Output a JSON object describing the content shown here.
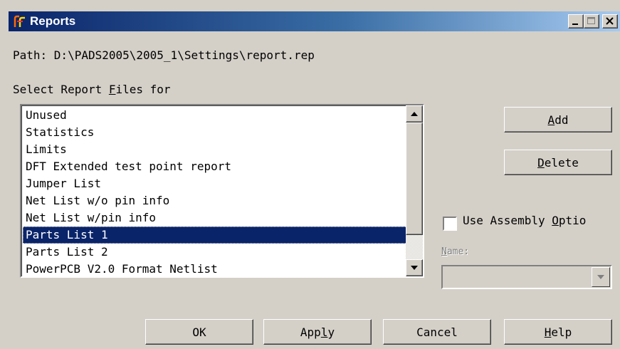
{
  "window": {
    "title": "Reports",
    "minimize_icon": "minimize-icon",
    "maximize_icon": "maximize-icon",
    "close_icon": "close-icon"
  },
  "path_text": "Path: D:\\PADS2005\\2005_1\\Settings\\report.rep",
  "select_label": {
    "prefix": "Select Report ",
    "mnemonic": "F",
    "suffix": "iles for"
  },
  "report_list": {
    "items": [
      "Unused",
      "Statistics",
      "Limits",
      "DFT Extended test point report",
      "Jumper List",
      "Net List w/o pin info",
      "Net List w/pin info",
      "Parts List 1",
      "Parts List 2",
      "PowerPCB V2.0 Format Netlist"
    ],
    "selected": "Parts List 1"
  },
  "buttons": {
    "add": {
      "mnemonic": "A",
      "rest": "dd"
    },
    "delete": {
      "mnemonic": "D",
      "rest": "elete"
    },
    "ok": "OK",
    "apply": {
      "pre": "App",
      "mnemonic": "l",
      "rest": "y"
    },
    "cancel": "Cancel",
    "help": {
      "mnemonic": "H",
      "rest": "elp"
    }
  },
  "assembly_option": {
    "prefix": "Use Assembly ",
    "mnemonic": "O",
    "suffix": "ptio",
    "checked": false
  },
  "name_field": {
    "prefix": "",
    "mnemonic": "N",
    "suffix": "ame:",
    "value": "",
    "enabled": false
  },
  "colors": {
    "title_gradient_start": "#0a246a",
    "title_gradient_end": "#a6caf0",
    "selection": "#0a246a",
    "dialog_face": "#d4d0c8"
  }
}
